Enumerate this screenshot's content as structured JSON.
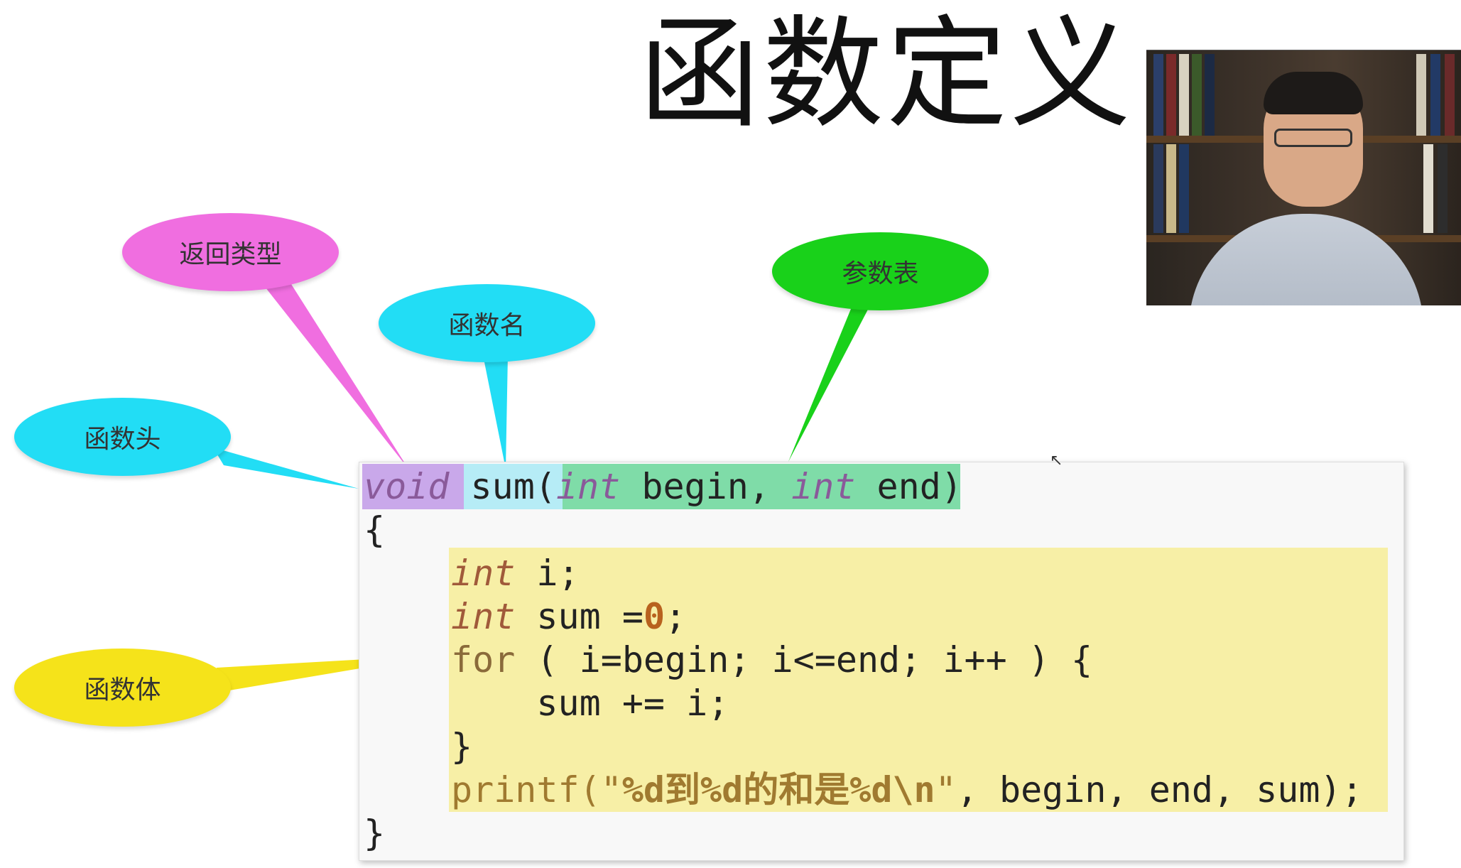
{
  "slide": {
    "title": "函数定义"
  },
  "labels": {
    "return_type": "返回类型",
    "function_name": "函数名",
    "parameter_list": "参数表",
    "function_head": "函数头",
    "function_body": "函数体"
  },
  "colors": {
    "return_type": "#f06ee0",
    "function_name": "#22ddf5",
    "parameter_list": "#19d11a",
    "function_head": "#22ddf5",
    "function_body": "#f5e31a",
    "code_bg": "#f8f8f8",
    "head_void_hl": "#c9a8ea",
    "head_name_hl": "#b6ecf6",
    "head_params_hl": "#7fdca8",
    "body_hl": "#f7efa6"
  },
  "code": {
    "line1": {
      "kw": "void",
      "name": " sum(",
      "kw2": "int",
      "p1": " begin, ",
      "kw3": "int",
      "p2": " end",
      "close": ")"
    },
    "line2": "{",
    "line3": {
      "kw": "int",
      "rest": " i;"
    },
    "line4": {
      "kw": "int",
      "rest": " sum =",
      "num": "0",
      "end": ";"
    },
    "line5": {
      "kw": "for",
      "rest": " ( i=begin; i<=end; i++ ) {"
    },
    "line6": "    sum += i;",
    "line7": "}",
    "line8": {
      "fn": "printf(",
      "q1": "\"",
      "fmt": "%d到%d的和是%d\\n",
      "q2": "\"",
      "rest": ", begin, end, sum);"
    },
    "line9": "}"
  }
}
